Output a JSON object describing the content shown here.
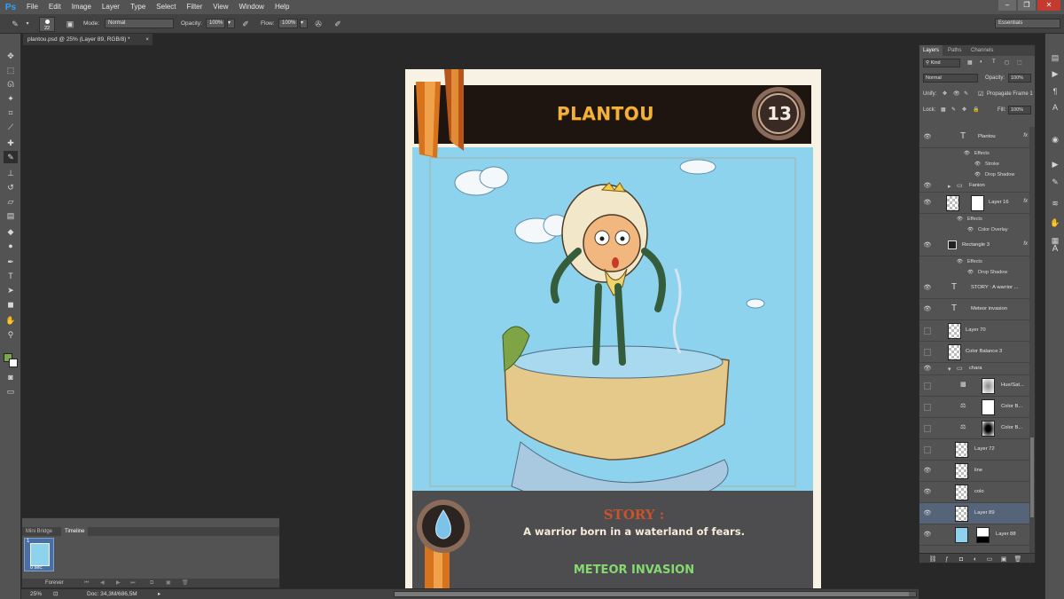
{
  "app": {
    "logo": "Ps"
  },
  "menu": [
    "File",
    "Edit",
    "Image",
    "Layer",
    "Type",
    "Select",
    "Filter",
    "View",
    "Window",
    "Help"
  ],
  "window_controls": {
    "minimize": "–",
    "restore": "❐",
    "close": "✕"
  },
  "options_bar": {
    "brush_size": "22",
    "mode_label": "Mode:",
    "mode_value": "Normal",
    "opacity_label": "Opacity:",
    "opacity_value": "100%",
    "flow_label": "Flow:",
    "flow_value": "100%"
  },
  "workspace": {
    "label": "Essentials"
  },
  "document": {
    "tab_title": "plantou.psd @ 25% (Layer 89, RGB/8) *",
    "close": "×"
  },
  "card": {
    "title": "PLANTOU",
    "cost": "13",
    "story_heading": "STORY :",
    "story_text": "A warrior born in a waterland of fears.",
    "ability": "METEOR INVASION",
    "colors": {
      "sky": "#8ed3ee",
      "banner": "#1e1410",
      "footer": "#4d4d4f",
      "title": "#f2b138",
      "story_head": "#c8532a",
      "ability": "#86d870",
      "rock": "#e5c98a",
      "ribbon": "#d7721d"
    }
  },
  "bottom_panel": {
    "tabs": [
      "Mini Bridge",
      "Timeline"
    ],
    "active_tab": "Timeline",
    "frame_number": "1",
    "frame_delay": "0 sec.",
    "loop": "Forever"
  },
  "status_bar": {
    "zoom": "25%",
    "doc_info": "Doc: 34,3M/686,5M"
  },
  "layers_panel": {
    "tabs": [
      "Layers",
      "Paths",
      "Channels"
    ],
    "active_tab": "Layers",
    "filter_label": "Kind",
    "blend_mode": "Normal",
    "opacity_label": "Opacity:",
    "opacity_value": "100%",
    "unify_label": "Unify:",
    "propagate_label": "Propagate Frame 1",
    "lock_label": "Lock:",
    "fill_label": "Fill:",
    "fill_value": "100%",
    "rows": {
      "plantou": "Plantou",
      "plantou_effects": "Effects",
      "plantou_stroke": "Stroke",
      "plantou_drop_shadow": "Drop Shadow",
      "fanion": "Fanion",
      "layer16": "Layer 16",
      "layer16_effects": "Effects",
      "layer16_color_overlay": "Color Overlay",
      "rectangle3": "Rectangle 3",
      "rectangle3_effects": "Effects",
      "rectangle3_drop_shadow": "Drop Shadow",
      "story": "STORY :  A warrior ...",
      "meteor": "Meteor invasion",
      "layer70": "Layer 70",
      "color_balance3": "Color Balance 3",
      "chara": "chara",
      "hue_sat": "Hue/Sat...",
      "color_b1": "Color B...",
      "color_b2": "Color B...",
      "layer72": "Layer 72",
      "line": "line",
      "colo": "colo",
      "layer89": "Layer 89",
      "layer88": "Layer 88"
    },
    "fx_badge": "fx"
  }
}
